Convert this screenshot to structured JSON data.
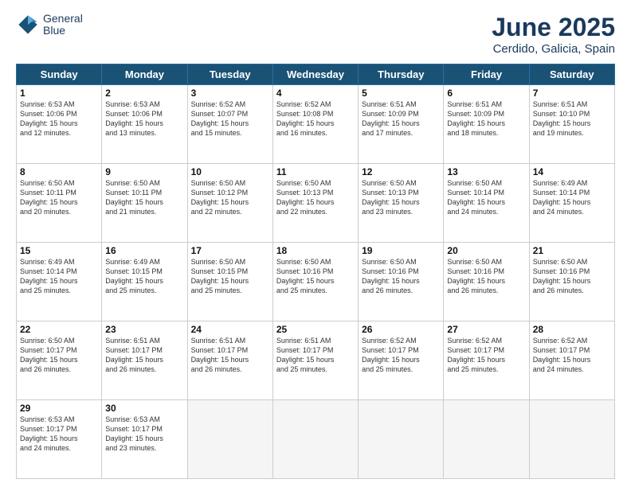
{
  "logo": {
    "line1": "General",
    "line2": "Blue"
  },
  "title": "June 2025",
  "subtitle": "Cerdido, Galicia, Spain",
  "days_of_week": [
    "Sunday",
    "Monday",
    "Tuesday",
    "Wednesday",
    "Thursday",
    "Friday",
    "Saturday"
  ],
  "weeks": [
    [
      {
        "day": "1",
        "info": "Sunrise: 6:53 AM\nSunset: 10:06 PM\nDaylight: 15 hours\nand 12 minutes."
      },
      {
        "day": "2",
        "info": "Sunrise: 6:53 AM\nSunset: 10:06 PM\nDaylight: 15 hours\nand 13 minutes."
      },
      {
        "day": "3",
        "info": "Sunrise: 6:52 AM\nSunset: 10:07 PM\nDaylight: 15 hours\nand 15 minutes."
      },
      {
        "day": "4",
        "info": "Sunrise: 6:52 AM\nSunset: 10:08 PM\nDaylight: 15 hours\nand 16 minutes."
      },
      {
        "day": "5",
        "info": "Sunrise: 6:51 AM\nSunset: 10:09 PM\nDaylight: 15 hours\nand 17 minutes."
      },
      {
        "day": "6",
        "info": "Sunrise: 6:51 AM\nSunset: 10:09 PM\nDaylight: 15 hours\nand 18 minutes."
      },
      {
        "day": "7",
        "info": "Sunrise: 6:51 AM\nSunset: 10:10 PM\nDaylight: 15 hours\nand 19 minutes."
      }
    ],
    [
      {
        "day": "8",
        "info": "Sunrise: 6:50 AM\nSunset: 10:11 PM\nDaylight: 15 hours\nand 20 minutes."
      },
      {
        "day": "9",
        "info": "Sunrise: 6:50 AM\nSunset: 10:11 PM\nDaylight: 15 hours\nand 21 minutes."
      },
      {
        "day": "10",
        "info": "Sunrise: 6:50 AM\nSunset: 10:12 PM\nDaylight: 15 hours\nand 22 minutes."
      },
      {
        "day": "11",
        "info": "Sunrise: 6:50 AM\nSunset: 10:13 PM\nDaylight: 15 hours\nand 22 minutes."
      },
      {
        "day": "12",
        "info": "Sunrise: 6:50 AM\nSunset: 10:13 PM\nDaylight: 15 hours\nand 23 minutes."
      },
      {
        "day": "13",
        "info": "Sunrise: 6:50 AM\nSunset: 10:14 PM\nDaylight: 15 hours\nand 24 minutes."
      },
      {
        "day": "14",
        "info": "Sunrise: 6:49 AM\nSunset: 10:14 PM\nDaylight: 15 hours\nand 24 minutes."
      }
    ],
    [
      {
        "day": "15",
        "info": "Sunrise: 6:49 AM\nSunset: 10:14 PM\nDaylight: 15 hours\nand 25 minutes."
      },
      {
        "day": "16",
        "info": "Sunrise: 6:49 AM\nSunset: 10:15 PM\nDaylight: 15 hours\nand 25 minutes."
      },
      {
        "day": "17",
        "info": "Sunrise: 6:50 AM\nSunset: 10:15 PM\nDaylight: 15 hours\nand 25 minutes."
      },
      {
        "day": "18",
        "info": "Sunrise: 6:50 AM\nSunset: 10:16 PM\nDaylight: 15 hours\nand 25 minutes."
      },
      {
        "day": "19",
        "info": "Sunrise: 6:50 AM\nSunset: 10:16 PM\nDaylight: 15 hours\nand 26 minutes."
      },
      {
        "day": "20",
        "info": "Sunrise: 6:50 AM\nSunset: 10:16 PM\nDaylight: 15 hours\nand 26 minutes."
      },
      {
        "day": "21",
        "info": "Sunrise: 6:50 AM\nSunset: 10:16 PM\nDaylight: 15 hours\nand 26 minutes."
      }
    ],
    [
      {
        "day": "22",
        "info": "Sunrise: 6:50 AM\nSunset: 10:17 PM\nDaylight: 15 hours\nand 26 minutes."
      },
      {
        "day": "23",
        "info": "Sunrise: 6:51 AM\nSunset: 10:17 PM\nDaylight: 15 hours\nand 26 minutes."
      },
      {
        "day": "24",
        "info": "Sunrise: 6:51 AM\nSunset: 10:17 PM\nDaylight: 15 hours\nand 26 minutes."
      },
      {
        "day": "25",
        "info": "Sunrise: 6:51 AM\nSunset: 10:17 PM\nDaylight: 15 hours\nand 25 minutes."
      },
      {
        "day": "26",
        "info": "Sunrise: 6:52 AM\nSunset: 10:17 PM\nDaylight: 15 hours\nand 25 minutes."
      },
      {
        "day": "27",
        "info": "Sunrise: 6:52 AM\nSunset: 10:17 PM\nDaylight: 15 hours\nand 25 minutes."
      },
      {
        "day": "28",
        "info": "Sunrise: 6:52 AM\nSunset: 10:17 PM\nDaylight: 15 hours\nand 24 minutes."
      }
    ],
    [
      {
        "day": "29",
        "info": "Sunrise: 6:53 AM\nSunset: 10:17 PM\nDaylight: 15 hours\nand 24 minutes."
      },
      {
        "day": "30",
        "info": "Sunrise: 6:53 AM\nSunset: 10:17 PM\nDaylight: 15 hours\nand 23 minutes."
      },
      {
        "day": "",
        "info": ""
      },
      {
        "day": "",
        "info": ""
      },
      {
        "day": "",
        "info": ""
      },
      {
        "day": "",
        "info": ""
      },
      {
        "day": "",
        "info": ""
      }
    ]
  ]
}
